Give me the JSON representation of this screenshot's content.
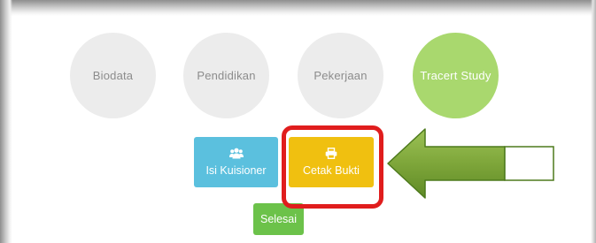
{
  "steps": [
    {
      "label": "Biodata",
      "active": false
    },
    {
      "label": "Pendidikan",
      "active": false
    },
    {
      "label": "Pekerjaan",
      "active": false
    },
    {
      "label": "Tracert Study",
      "active": true
    }
  ],
  "actions": {
    "kuisioner": {
      "label": "Isi Kuisioner",
      "icon": "users-icon"
    },
    "cetak": {
      "label": "Cetak Bukti",
      "icon": "printer-icon"
    },
    "selesai": {
      "label": "Selesai"
    }
  },
  "colors": {
    "step_inactive": "#ececec",
    "step_active": "#a9d86e",
    "kuisioner_button": "#5bc0de",
    "cetak_button": "#f0c010",
    "selesai_button": "#6cc24a",
    "highlight_border": "#e01d1d",
    "arrow_fill": "#7ea63a"
  }
}
